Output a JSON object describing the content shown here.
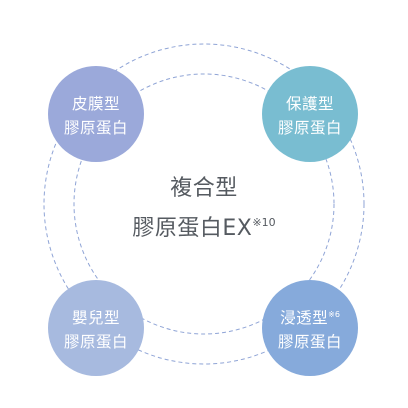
{
  "center": {
    "line1": "複合型",
    "line2": "膠原蛋白EX",
    "note": "※10"
  },
  "bubbles": [
    {
      "line1": "皮膜型",
      "note": "",
      "line2": "膠原蛋白",
      "color": "#9ba9da"
    },
    {
      "line1": "保護型",
      "note": "",
      "line2": "膠原蛋白",
      "color": "#79bdd1"
    },
    {
      "line1": "嬰兒型",
      "note": "",
      "line2": "膠原蛋白",
      "color": "#a7badf"
    },
    {
      "line1": "浸透型",
      "note": "※6",
      "line2": "膠原蛋白",
      "color": "#86aadb"
    }
  ],
  "colors": {
    "ring": "#8fa4d6",
    "text": "#555a60"
  }
}
